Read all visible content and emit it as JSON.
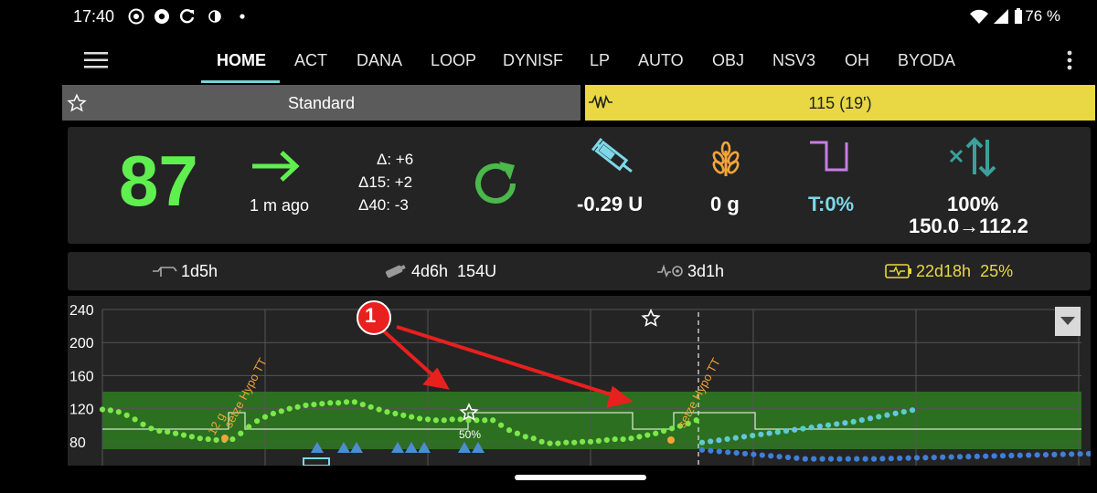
{
  "status_bar": {
    "time": "17:40",
    "battery": "76 %",
    "icons": [
      "whatsapp-icon",
      "chrome-icon",
      "sync-icon",
      "contrast-icon",
      "dot-icon"
    ],
    "right_icons": [
      "wifi-icon",
      "signal-icon",
      "battery-icon"
    ]
  },
  "tabs": [
    "HOME",
    "ACT",
    "DANA",
    "LOOP",
    "DYNISF",
    "LP",
    "AUTO",
    "OBJ",
    "NSV3",
    "OH",
    "BYODA"
  ],
  "active_tab": "HOME",
  "profile": {
    "label": "Standard",
    "icon": "star-icon"
  },
  "target": {
    "label": "115 (19')",
    "icon": "temp-target-icon"
  },
  "overview": {
    "bg": "87",
    "bg_color": "#5fef4f",
    "trend": "arrow-right-icon",
    "ago": "1 m ago",
    "delta": "Δ: +6",
    "delta15": "Δ15: +2",
    "delta40": "Δ40:  -3",
    "iob": "-0.29 U",
    "cob": "0 g",
    "temp_basal": "T:0%",
    "autosens_pct": "100%",
    "autosens_range": "150.0→112.2"
  },
  "statusline": {
    "cannula_age": "1d5h",
    "insulin_age": "4d6h  154U",
    "sensor_age": "3d1h",
    "battery_age": "22d18h  25%"
  },
  "graph": {
    "y_labels": [
      "240",
      "200",
      "160",
      "120",
      "80"
    ],
    "annotation_number": "1",
    "carbs_label": "12 g",
    "hypo_label_1": "setze Hypo TT",
    "hypo_label_2": "setze Hypo TT",
    "smb_pct": "50%"
  },
  "chart_data": {
    "type": "scatter",
    "ylim": [
      60,
      250
    ],
    "target_range": [
      70,
      140
    ],
    "bg_points": [
      119,
      118,
      116,
      112,
      107,
      101,
      96,
      93,
      92,
      90,
      88,
      86,
      84,
      83,
      82,
      82,
      83,
      90,
      98,
      105,
      110,
      114,
      117,
      120,
      122,
      124,
      125,
      126,
      127,
      127,
      128,
      128,
      125,
      122,
      119,
      116,
      114,
      112,
      110,
      108,
      107,
      106,
      106,
      107,
      107,
      106,
      106,
      106,
      106,
      100,
      94,
      90,
      86,
      84,
      80,
      78,
      78,
      79,
      79,
      80,
      80,
      81,
      82,
      83,
      83,
      84,
      86,
      88,
      90,
      93,
      96,
      99,
      102,
      106,
      109,
      112
    ]
  }
}
